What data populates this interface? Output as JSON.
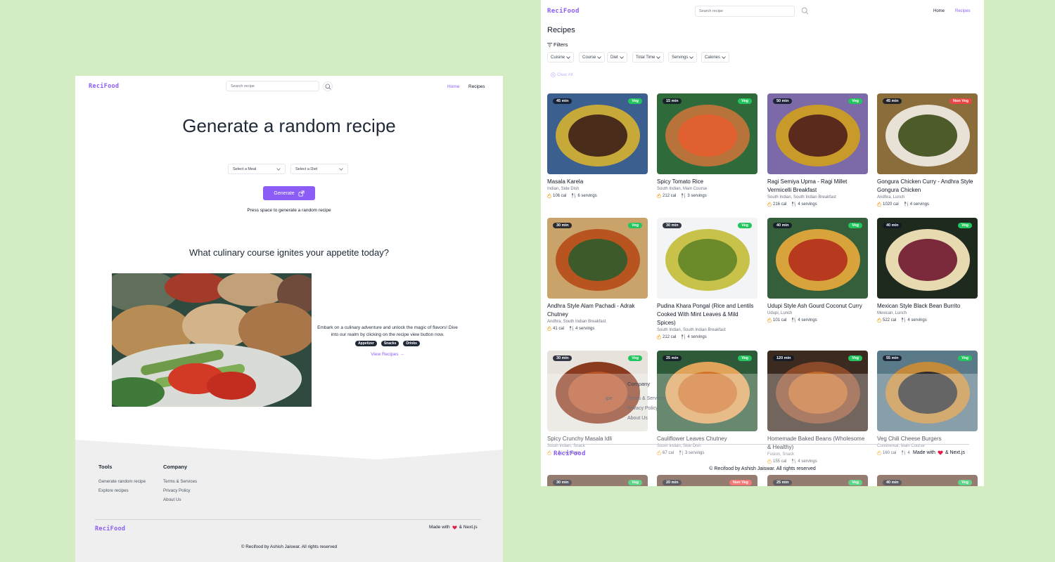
{
  "left": {
    "logo": "ReciFood",
    "search_placeholder": "Search recipe",
    "nav": {
      "home": "Home",
      "recipes": "Recipes"
    },
    "hero_title": "Generate a random recipe",
    "meal_select": "Select a Meal",
    "diet_select": "Select a Diet",
    "generate_label": "Generate",
    "hint": "Press space to generate a random recipe",
    "question": "What culinary course ignites your appetite today?",
    "blurb": "Embark on a culinary adventure and unlock the magic of flavors! Dive into our realm by clicking on the recipe view button now.",
    "tags": [
      "Appetizer",
      "Snacks",
      "Drinks"
    ],
    "view_recipes": "View Recipes →",
    "footer": {
      "tools_heading": "Tools",
      "tools": [
        "Generate random recipe",
        "Explore recipes"
      ],
      "company_heading": "Company",
      "company": [
        "Terms & Services",
        "Privacy Policy",
        "About Us"
      ],
      "logo": "ReciFood",
      "made_with": "Made with",
      "made_with_after": "& Next.js",
      "copyright_prefix": "© Recifood by",
      "author": "Ashish Jaiswar",
      "copyright_suffix": ". All rights reserved"
    }
  },
  "right": {
    "logo": "ReciFood",
    "search_placeholder": "Search recipe",
    "nav": {
      "home": "Home",
      "recipes": "Recipes"
    },
    "page_title": "Recipes",
    "filters_label": "Filters",
    "filter_chips": [
      "Cuisine",
      "Course",
      "Diet",
      "Total Time",
      "Servings",
      "Calories"
    ],
    "clear_all": "Clear All",
    "recipes": [
      {
        "time": "45 min",
        "diet": "Veg",
        "title": "Masala Karela",
        "sub": "Indian, Side Dish",
        "cal": "106 cal",
        "serv": "6 servings"
      },
      {
        "time": "15 min",
        "diet": "Veg",
        "title": "Spicy Tomato Rice",
        "sub": "South Indian, Main Course",
        "cal": "212 cal",
        "serv": "3 servings"
      },
      {
        "time": "50 min",
        "diet": "Veg",
        "title": "Ragi Semiya Upma - Ragi Millet Vermicelli Breakfast",
        "sub": "South Indian, South Indian Breakfast",
        "cal": "216 cal",
        "serv": "4 servings"
      },
      {
        "time": "45 min",
        "diet": "Non Veg",
        "title": "Gongura Chicken Curry - Andhra Style Gongura Chicken",
        "sub": "Andhra, Lunch",
        "cal": "1020 cal",
        "serv": "4 servings"
      },
      {
        "time": "30 min",
        "diet": "Veg",
        "title": "Andhra Style Alam Pachadi - Adrak Chutney",
        "sub": "Andhra, South Indian Breakfast",
        "cal": "41 cal",
        "serv": "4 servings"
      },
      {
        "time": "30 min",
        "diet": "Veg",
        "title": "Pudina Khara Pongal (Rice and Lentils Cooked With Mint Leaves & Mild Spices)",
        "sub": "South Indian, South Indian Breakfast",
        "cal": "212 cal",
        "serv": "4 servings"
      },
      {
        "time": "40 min",
        "diet": "Veg",
        "title": "Udupi Style Ash Gourd Coconut Curry",
        "sub": "Udupi, Lunch",
        "cal": "101 cal",
        "serv": "4 servings"
      },
      {
        "time": "40 min",
        "diet": "Veg",
        "title": "Mexican Style Black Bean Burrito",
        "sub": "Mexican, Lunch",
        "cal": "522 cal",
        "serv": "4 servings"
      },
      {
        "time": "30 min",
        "diet": "Veg",
        "title": "Spicy Crunchy Masala Idli",
        "sub": "South Indian, Snack",
        "cal": "",
        "serv": "servings"
      },
      {
        "time": "25 min",
        "diet": "Veg",
        "title": "Cauliflower Leaves Chutney",
        "sub": "South Indian, Side Dish",
        "cal": "67 cal",
        "serv": "3 servings"
      },
      {
        "time": "120 min",
        "diet": "Veg",
        "title": "Homemade Baked Beans (Wholesome & Healthy)",
        "sub": "Fusion, Snack",
        "cal": "155 cal",
        "serv": "4 servings"
      },
      {
        "time": "55 min",
        "diet": "Veg",
        "title": "Veg Chili Cheese Burgers",
        "sub": "Continental, Main Course",
        "cal": "160 cal",
        "serv": "4"
      }
    ],
    "bottom_times": [
      {
        "time": "30 min",
        "diet": "Veg"
      },
      {
        "time": "20 min",
        "diet": "Non Veg"
      },
      {
        "time": "25 min",
        "diet": "Veg"
      },
      {
        "time": "40 min",
        "diet": "Veg"
      }
    ],
    "overlay": {
      "company": "Company",
      "company_links": [
        "Terms & Services",
        "Privacy Policy",
        "About Us"
      ],
      "ipe": "ipe",
      "logo": "ReciFood",
      "made_with": "Made with",
      "made_with_after": "& Next.js",
      "copyright_prefix": "© Recifood by",
      "author": "Ashish Jaiswar",
      "copyright_suffix": ". All rights reserved"
    }
  },
  "colors": {
    "accent": "#8b5cf6",
    "veg": "#22c55e",
    "nonveg": "#ef4444",
    "footer_bg": "#efefef",
    "page_bg": "#d4ecc2"
  }
}
